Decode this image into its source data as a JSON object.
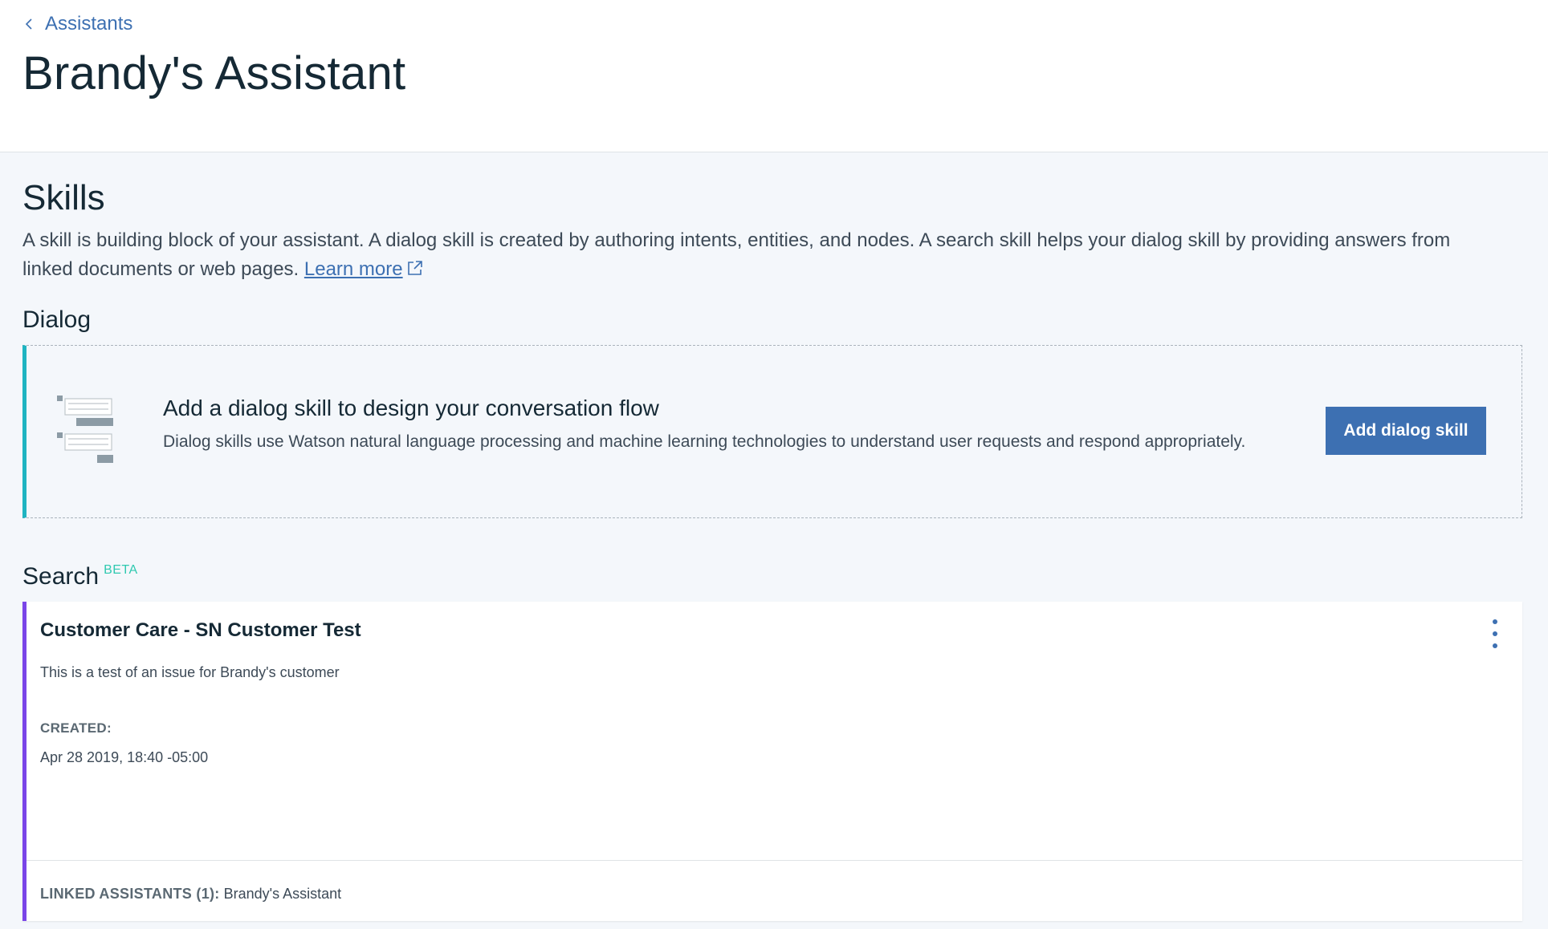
{
  "breadcrumb": {
    "label": "Assistants",
    "icon": "chevron-left-icon"
  },
  "page": {
    "title": "Brandy's Assistant"
  },
  "skills": {
    "title": "Skills",
    "description": "A skill is building block of your assistant. A dialog skill is created by authoring intents, entities, and nodes. A search skill helps your dialog skill by providing answers from linked documents or web pages.",
    "learn_more": "Learn more",
    "learn_more_icon": "external-link-icon"
  },
  "dialog": {
    "section_title": "Dialog",
    "card_title": "Add a dialog skill to design your conversation flow",
    "card_description": "Dialog skills use Watson natural language processing and machine learning technologies to understand user requests and respond appropriately.",
    "button_label": "Add dialog skill",
    "illustration_icon": "dialog-illustration-icon",
    "accent_color": "#1fb4c1"
  },
  "search": {
    "section_title": "Search",
    "badge": "BETA",
    "card": {
      "title": "Customer Care - SN Customer Test",
      "description": "This is a test of an issue for Brandy's customer",
      "created_label": "CREATED:",
      "created_value": "Apr 28 2019, 18:40 -05:00",
      "linked_label": "LINKED ASSISTANTS (1):",
      "linked_value": "Brandy's Assistant",
      "menu_icon": "overflow-menu-icon",
      "accent_color": "#7a45e8"
    }
  },
  "colors": {
    "link": "#3d70b2",
    "button": "#3d70b2",
    "beta": "#2fc9b0",
    "background": "#f4f7fb"
  }
}
